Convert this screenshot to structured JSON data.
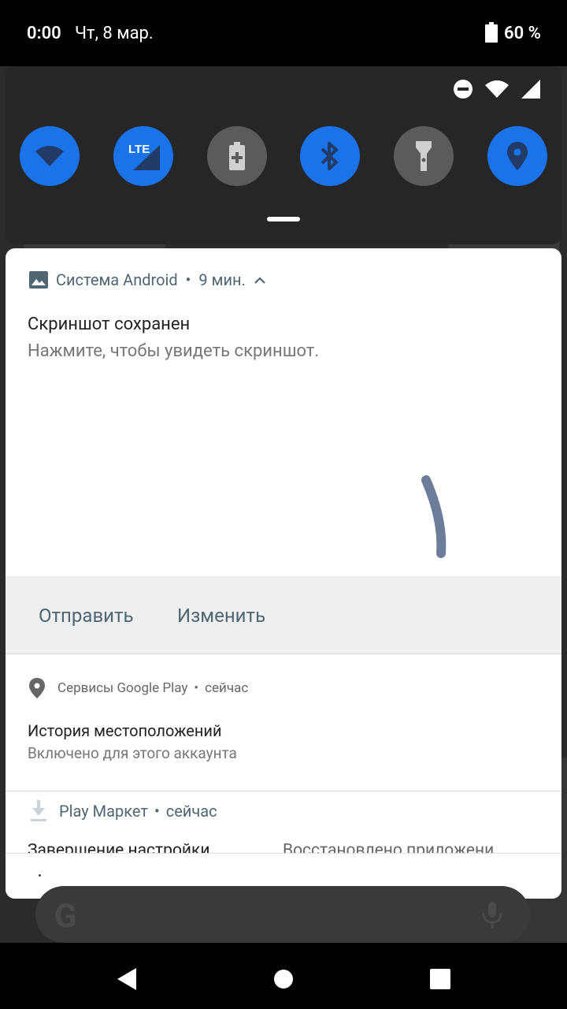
{
  "statusbar": {
    "time": "0:00",
    "date": "Чт, 8 мар.",
    "battery": "60 %"
  },
  "quick_settings": {
    "tiles": [
      {
        "name": "wifi-icon",
        "state": "on"
      },
      {
        "name": "lte-icon",
        "label": "LTE",
        "state": "on"
      },
      {
        "name": "battery-saver-icon",
        "state": "off"
      },
      {
        "name": "bluetooth-icon",
        "state": "on"
      },
      {
        "name": "flashlight-icon",
        "state": "off"
      },
      {
        "name": "location-icon",
        "state": "on"
      }
    ]
  },
  "notifications": [
    {
      "app": "Система Android",
      "time": "9 мин.",
      "title": "Скриншот сохранен",
      "text": "Нажмите, чтобы увидеть скриншот.",
      "actions": [
        "Отправить",
        "Изменить"
      ]
    },
    {
      "app": "Сервисы Google Play",
      "time": "сейчас",
      "title": "История местоположений",
      "text": "Включено для этого аккаунта"
    },
    {
      "app": "Play Маркет",
      "time": "сейчас",
      "title": "Завершение настройки",
      "text": "Восстановлено приложени"
    }
  ],
  "colors": {
    "accent": "#1a73e8",
    "app_label": "#4f6673",
    "tile_off": "#5b5b5b"
  }
}
